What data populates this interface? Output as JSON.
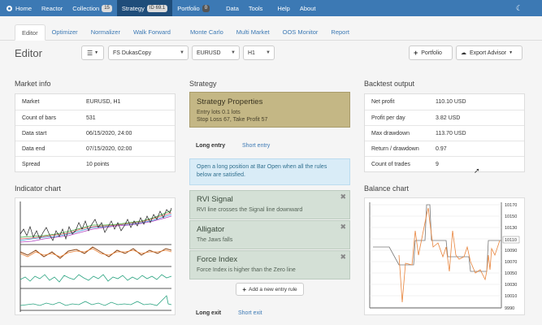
{
  "topnav": {
    "items": [
      {
        "label": "Home"
      },
      {
        "label": "Reactor"
      },
      {
        "label": "Collection",
        "badge": "15"
      },
      {
        "label": "Strategy",
        "badge": "ID 69.1"
      },
      {
        "label": "Portfolio",
        "badge": "0"
      },
      {
        "label": "Data"
      },
      {
        "label": "Tools"
      },
      {
        "label": "Help"
      },
      {
        "label": "About"
      }
    ]
  },
  "subnav": {
    "tabs": [
      "Editor",
      "Optimizer",
      "Normalizer",
      "Walk Forward",
      "Monte Carlo",
      "Multi Market",
      "OOS Monitor",
      "Report"
    ]
  },
  "page": {
    "title": "Editor",
    "datasource": "FS DukasCopy",
    "symbol": "EURUSD",
    "period": "H1",
    "portfolio_button": "Portfolio",
    "export_button": "Export Advisor"
  },
  "market_info": {
    "title": "Market info",
    "rows": [
      {
        "label": "Market",
        "value": "EURUSD, H1"
      },
      {
        "label": "Count of bars",
        "value": "531"
      },
      {
        "label": "Data start",
        "value": "06/15/2020, 24:00"
      },
      {
        "label": "Data end",
        "value": "07/15/2020, 02:00"
      },
      {
        "label": "Spread",
        "value": "10 points"
      }
    ]
  },
  "indicator_chart": {
    "title": "Indicator chart"
  },
  "strategy": {
    "title": "Strategy",
    "properties_title": "Strategy Properties",
    "properties_line1": "Entry lots 0.1 lots",
    "properties_line2": "Stop Loss 67, Take Profit 57",
    "long_entry": "Long entry",
    "short_entry": "Short entry",
    "info_text": "Open a long position at Bar Open when all the rules below are satisfied.",
    "rules": [
      {
        "title": "RVI Signal",
        "desc": "RVI line crosses the Signal line downward"
      },
      {
        "title": "Alligator",
        "desc": "The Jaws falls"
      },
      {
        "title": "Force Index",
        "desc": "Force Index is higher than the Zero line"
      }
    ],
    "add_rule": "Add a new entry rule",
    "long_exit": "Long exit",
    "short_exit": "Short exit"
  },
  "backtest": {
    "title": "Backtest output",
    "rows": [
      {
        "label": "Net profit",
        "value": "110.10 USD"
      },
      {
        "label": "Profit per day",
        "value": "3.82 USD"
      },
      {
        "label": "Max drawdown",
        "value": "113.70 USD"
      },
      {
        "label": "Return / drawdown",
        "value": "0.97"
      },
      {
        "label": "Count of trades",
        "value": "9"
      }
    ]
  },
  "balance_chart": {
    "title": "Balance chart",
    "ticks": [
      "10170",
      "10150",
      "10130",
      "10110",
      "10090",
      "10070",
      "10050",
      "10030",
      "10010",
      "9990"
    ],
    "highlight_tick": "10110"
  },
  "colors": {
    "nav": "#3c79b4",
    "nav_active": "#1f4d7a",
    "props": "#c4b785",
    "rule": "#d4e0d6",
    "info": "#d9ecf7",
    "orange": "#e8833a"
  }
}
